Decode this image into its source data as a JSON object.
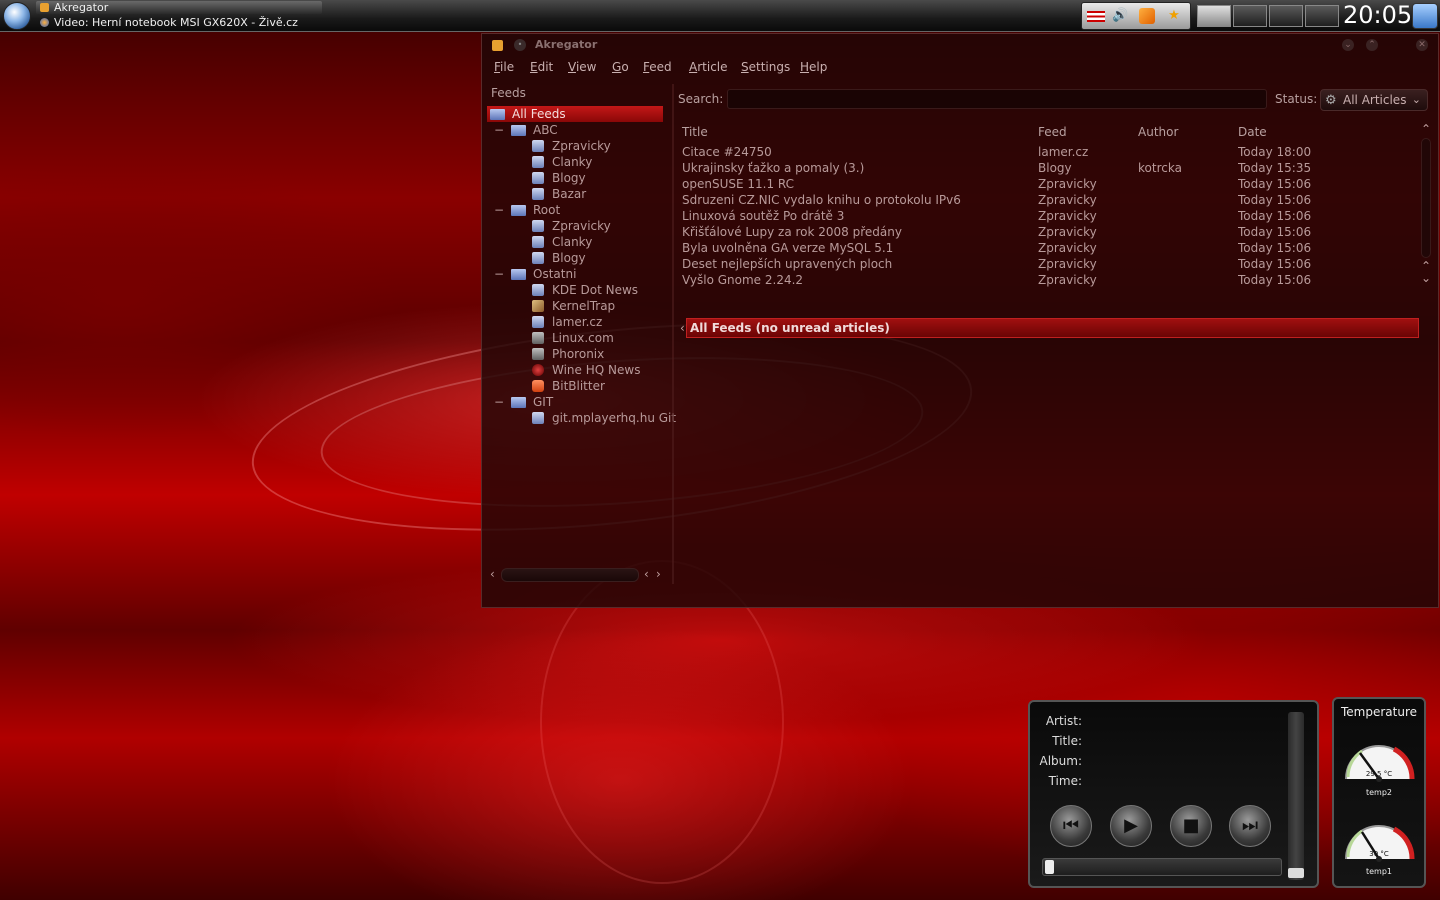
{
  "panel": {
    "tasks": [
      "Akregator",
      "Video: Herní notebook MSI GX620X - Živě.cz"
    ],
    "clock": "20:05",
    "tray_icons": [
      "us-flag-icon",
      "speaker-icon",
      "rss-icon",
      "star-icon"
    ]
  },
  "window": {
    "title": "Akregator",
    "menu": [
      "File",
      "Edit",
      "View",
      "Go",
      "Feed",
      "Article",
      "Settings",
      "Help"
    ],
    "feeds_label": "Feeds",
    "tree": [
      {
        "label": "All Feeds",
        "level": 0,
        "type": "root",
        "selected": true
      },
      {
        "label": "ABC",
        "level": 1,
        "type": "folder"
      },
      {
        "label": "Zpravicky",
        "level": 2,
        "type": "feed"
      },
      {
        "label": "Clanky",
        "level": 2,
        "type": "feed"
      },
      {
        "label": "Blogy",
        "level": 2,
        "type": "feed"
      },
      {
        "label": "Bazar",
        "level": 2,
        "type": "feed"
      },
      {
        "label": "Root",
        "level": 1,
        "type": "folder"
      },
      {
        "label": "Zpravicky",
        "level": 2,
        "type": "feed"
      },
      {
        "label": "Clanky",
        "level": 2,
        "type": "feed"
      },
      {
        "label": "Blogy",
        "level": 2,
        "type": "feed"
      },
      {
        "label": "Ostatni",
        "level": 1,
        "type": "folder"
      },
      {
        "label": "KDE Dot News",
        "level": 2,
        "type": "feed"
      },
      {
        "label": "KernelTrap",
        "level": 2,
        "type": "feed"
      },
      {
        "label": "lamer.cz",
        "level": 2,
        "type": "feed"
      },
      {
        "label": "Linux.com",
        "level": 2,
        "type": "feed"
      },
      {
        "label": "Phoronix",
        "level": 2,
        "type": "feed"
      },
      {
        "label": "Wine HQ News",
        "level": 2,
        "type": "feed"
      },
      {
        "label": "BitBlitter",
        "level": 2,
        "type": "feed"
      },
      {
        "label": "GIT",
        "level": 1,
        "type": "folder"
      },
      {
        "label": "git.mplayerhq.hu Git",
        "level": 2,
        "type": "feed"
      }
    ],
    "search": {
      "label": "Search:",
      "value": "",
      "placeholder": ""
    },
    "status": {
      "label": "Status:",
      "value": "All Articles"
    },
    "columns": [
      "Title",
      "Feed",
      "Author",
      "Date"
    ],
    "articles": [
      {
        "title": "Citace #24750",
        "feed": "lamer.cz",
        "author": "",
        "date": "Today 18:00"
      },
      {
        "title": "Ukrajinsky ťažko a pomaly (3.)",
        "feed": "Blogy",
        "author": "kotrcka",
        "date": "Today 15:35"
      },
      {
        "title": "openSUSE 11.1 RC",
        "feed": "Zpravicky",
        "author": "",
        "date": "Today 15:06"
      },
      {
        "title": "Sdruzeni CZ.NIC vydalo knihu o protokolu IPv6",
        "feed": "Zpravicky",
        "author": "",
        "date": "Today 15:06"
      },
      {
        "title": "Linuxová soutěž Po drátě 3",
        "feed": "Zpravicky",
        "author": "",
        "date": "Today 15:06"
      },
      {
        "title": "Křišťálové Lupy za rok 2008 předány",
        "feed": "Zpravicky",
        "author": "",
        "date": "Today 15:06"
      },
      {
        "title": "Byla uvolněna GA verze MySQL 5.1",
        "feed": "Zpravicky",
        "author": "",
        "date": "Today 15:06"
      },
      {
        "title": "Deset nejlepších upravených ploch",
        "feed": "Zpravicky",
        "author": "",
        "date": "Today 15:06"
      },
      {
        "title": "Vyšlo Gnome 2.24.2",
        "feed": "Zpravicky",
        "author": "",
        "date": "Today 15:06"
      }
    ],
    "article_header": "All Feeds (no unread articles)"
  },
  "player": {
    "labels": [
      "Artist:",
      "Title:",
      "Album:",
      "Time:"
    ],
    "buttons": [
      "previous-icon",
      "play-icon",
      "stop-icon",
      "next-icon"
    ],
    "seek_progress": 0,
    "volume_level": 0
  },
  "temperature": {
    "title": "Temperature",
    "gauges": [
      {
        "value_text": "29.5 °C",
        "name": "temp2",
        "value": 29.5
      },
      {
        "value_text": "30 °C",
        "name": "temp1",
        "value": 30
      }
    ]
  },
  "colors": {
    "accent": "#c41818",
    "wallpaper": "#a00000"
  }
}
